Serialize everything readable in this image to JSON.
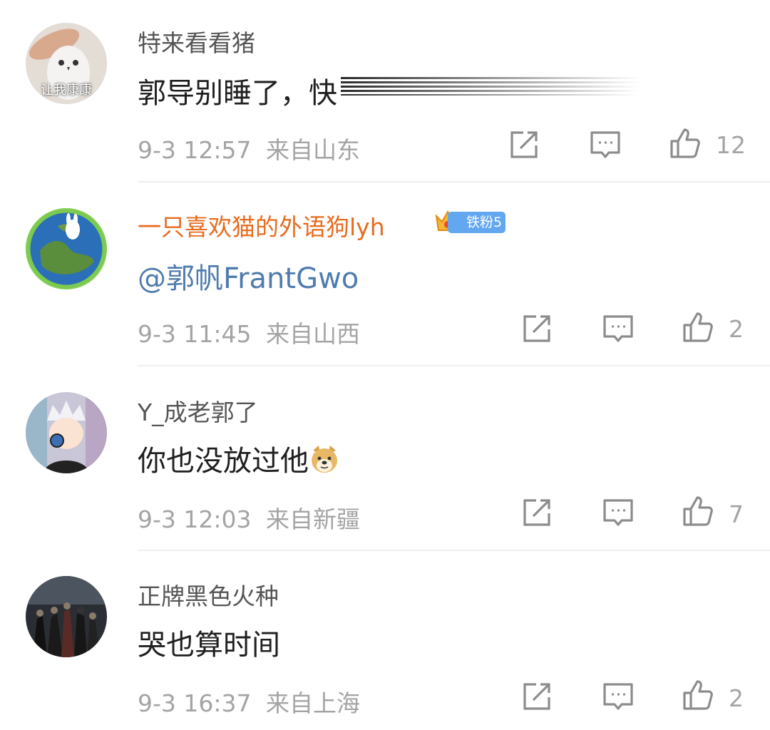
{
  "comments": [
    {
      "user": "特来看看猪",
      "avatar_label": "让我康康",
      "text": "郭导别睡了，快",
      "time": "9-3 12:57",
      "location": "来自山东",
      "likes": "12"
    },
    {
      "user": "一只喜欢猫的外语狗lyh",
      "badge": "铁粉5",
      "text": "@郭帆FrantGwo",
      "time": "9-3 11:45",
      "location": "来自山西",
      "likes": "2"
    },
    {
      "user": "Y_成老郭了",
      "text": "你也没放过他",
      "time": "9-3 12:03",
      "location": "来自新疆",
      "likes": "7"
    },
    {
      "user": "正牌黑色火种",
      "text": "哭也算时间",
      "time": "9-3 16:37",
      "location": "来自上海",
      "likes": "2"
    }
  ],
  "colors": {
    "username_default": "#555555",
    "username_vip": "#e86b1f",
    "mention": "#4f7cae",
    "meta": "#a4a4a4",
    "badge": "#63a7f0"
  },
  "icons": [
    "share-icon",
    "reply-icon",
    "like-icon",
    "crown-icon",
    "doge-emoji-icon"
  ]
}
